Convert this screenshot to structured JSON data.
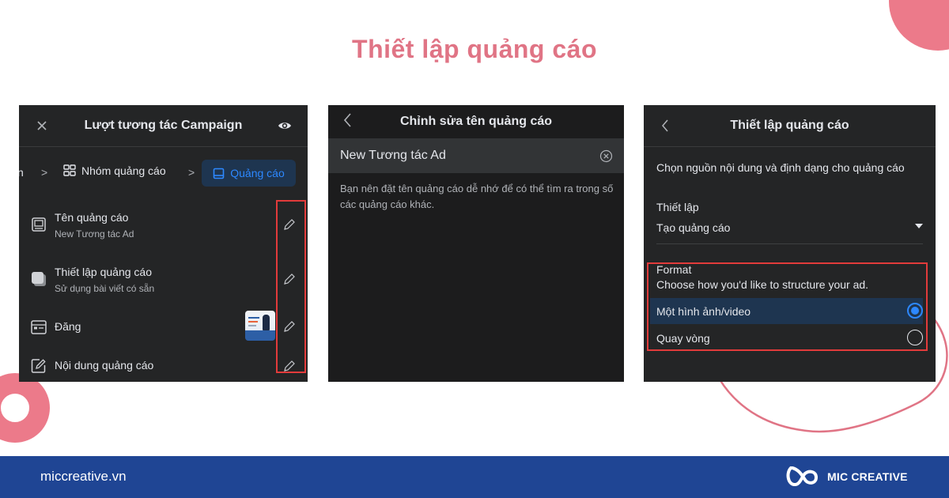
{
  "title": "Thiết lập quảng cáo",
  "colors": {
    "accent_pink": "#e07485",
    "highlight_red": "#e23b3b",
    "fb_blue": "#2d88ff",
    "footer_blue": "#1f4594"
  },
  "panel1": {
    "header_title": "Lượt tương tác Campaign",
    "close_icon": "close-icon",
    "preview_icon": "eye-icon",
    "breadcrumb": {
      "fragment": "n",
      "adset_label": "Nhóm quảng cáo",
      "ad_label": "Quảng cáo"
    },
    "rows": [
      {
        "title": "Tên quảng cáo",
        "subtitle": "New Tương tác Ad",
        "icon": "ad-name-icon"
      },
      {
        "title": "Thiết lập quảng cáo",
        "subtitle": "Sử dụng bài viết có sẵn",
        "icon": "ad-setup-icon"
      },
      {
        "title": "Đăng",
        "subtitle": "",
        "icon": "post-icon"
      },
      {
        "title": "Nội dung quảng cáo",
        "subtitle": "",
        "icon": "edit-content-icon"
      }
    ]
  },
  "panel2": {
    "header_title": "Chỉnh sửa tên quảng cáo",
    "name_value": "New Tương tác Ad",
    "help_text": "Bạn nên đặt tên quảng cáo dễ nhớ để có thể tìm ra trong số các quảng cáo khác."
  },
  "panel3": {
    "header_title": "Thiết lập quảng cáo",
    "description": "Chọn nguồn nội dung và định dạng cho quảng cáo",
    "setup_label": "Thiết lập",
    "setup_value": "Tạo quảng cáo",
    "format_title": "Format",
    "format_subtitle": "Choose how you'd like to structure your ad.",
    "options": [
      {
        "label": "Một hình ảnh/video",
        "selected": true
      },
      {
        "label": "Quay vòng",
        "selected": false
      }
    ]
  },
  "footer": {
    "site": "miccreative.vn",
    "brand": "MIC CREATIVE"
  }
}
